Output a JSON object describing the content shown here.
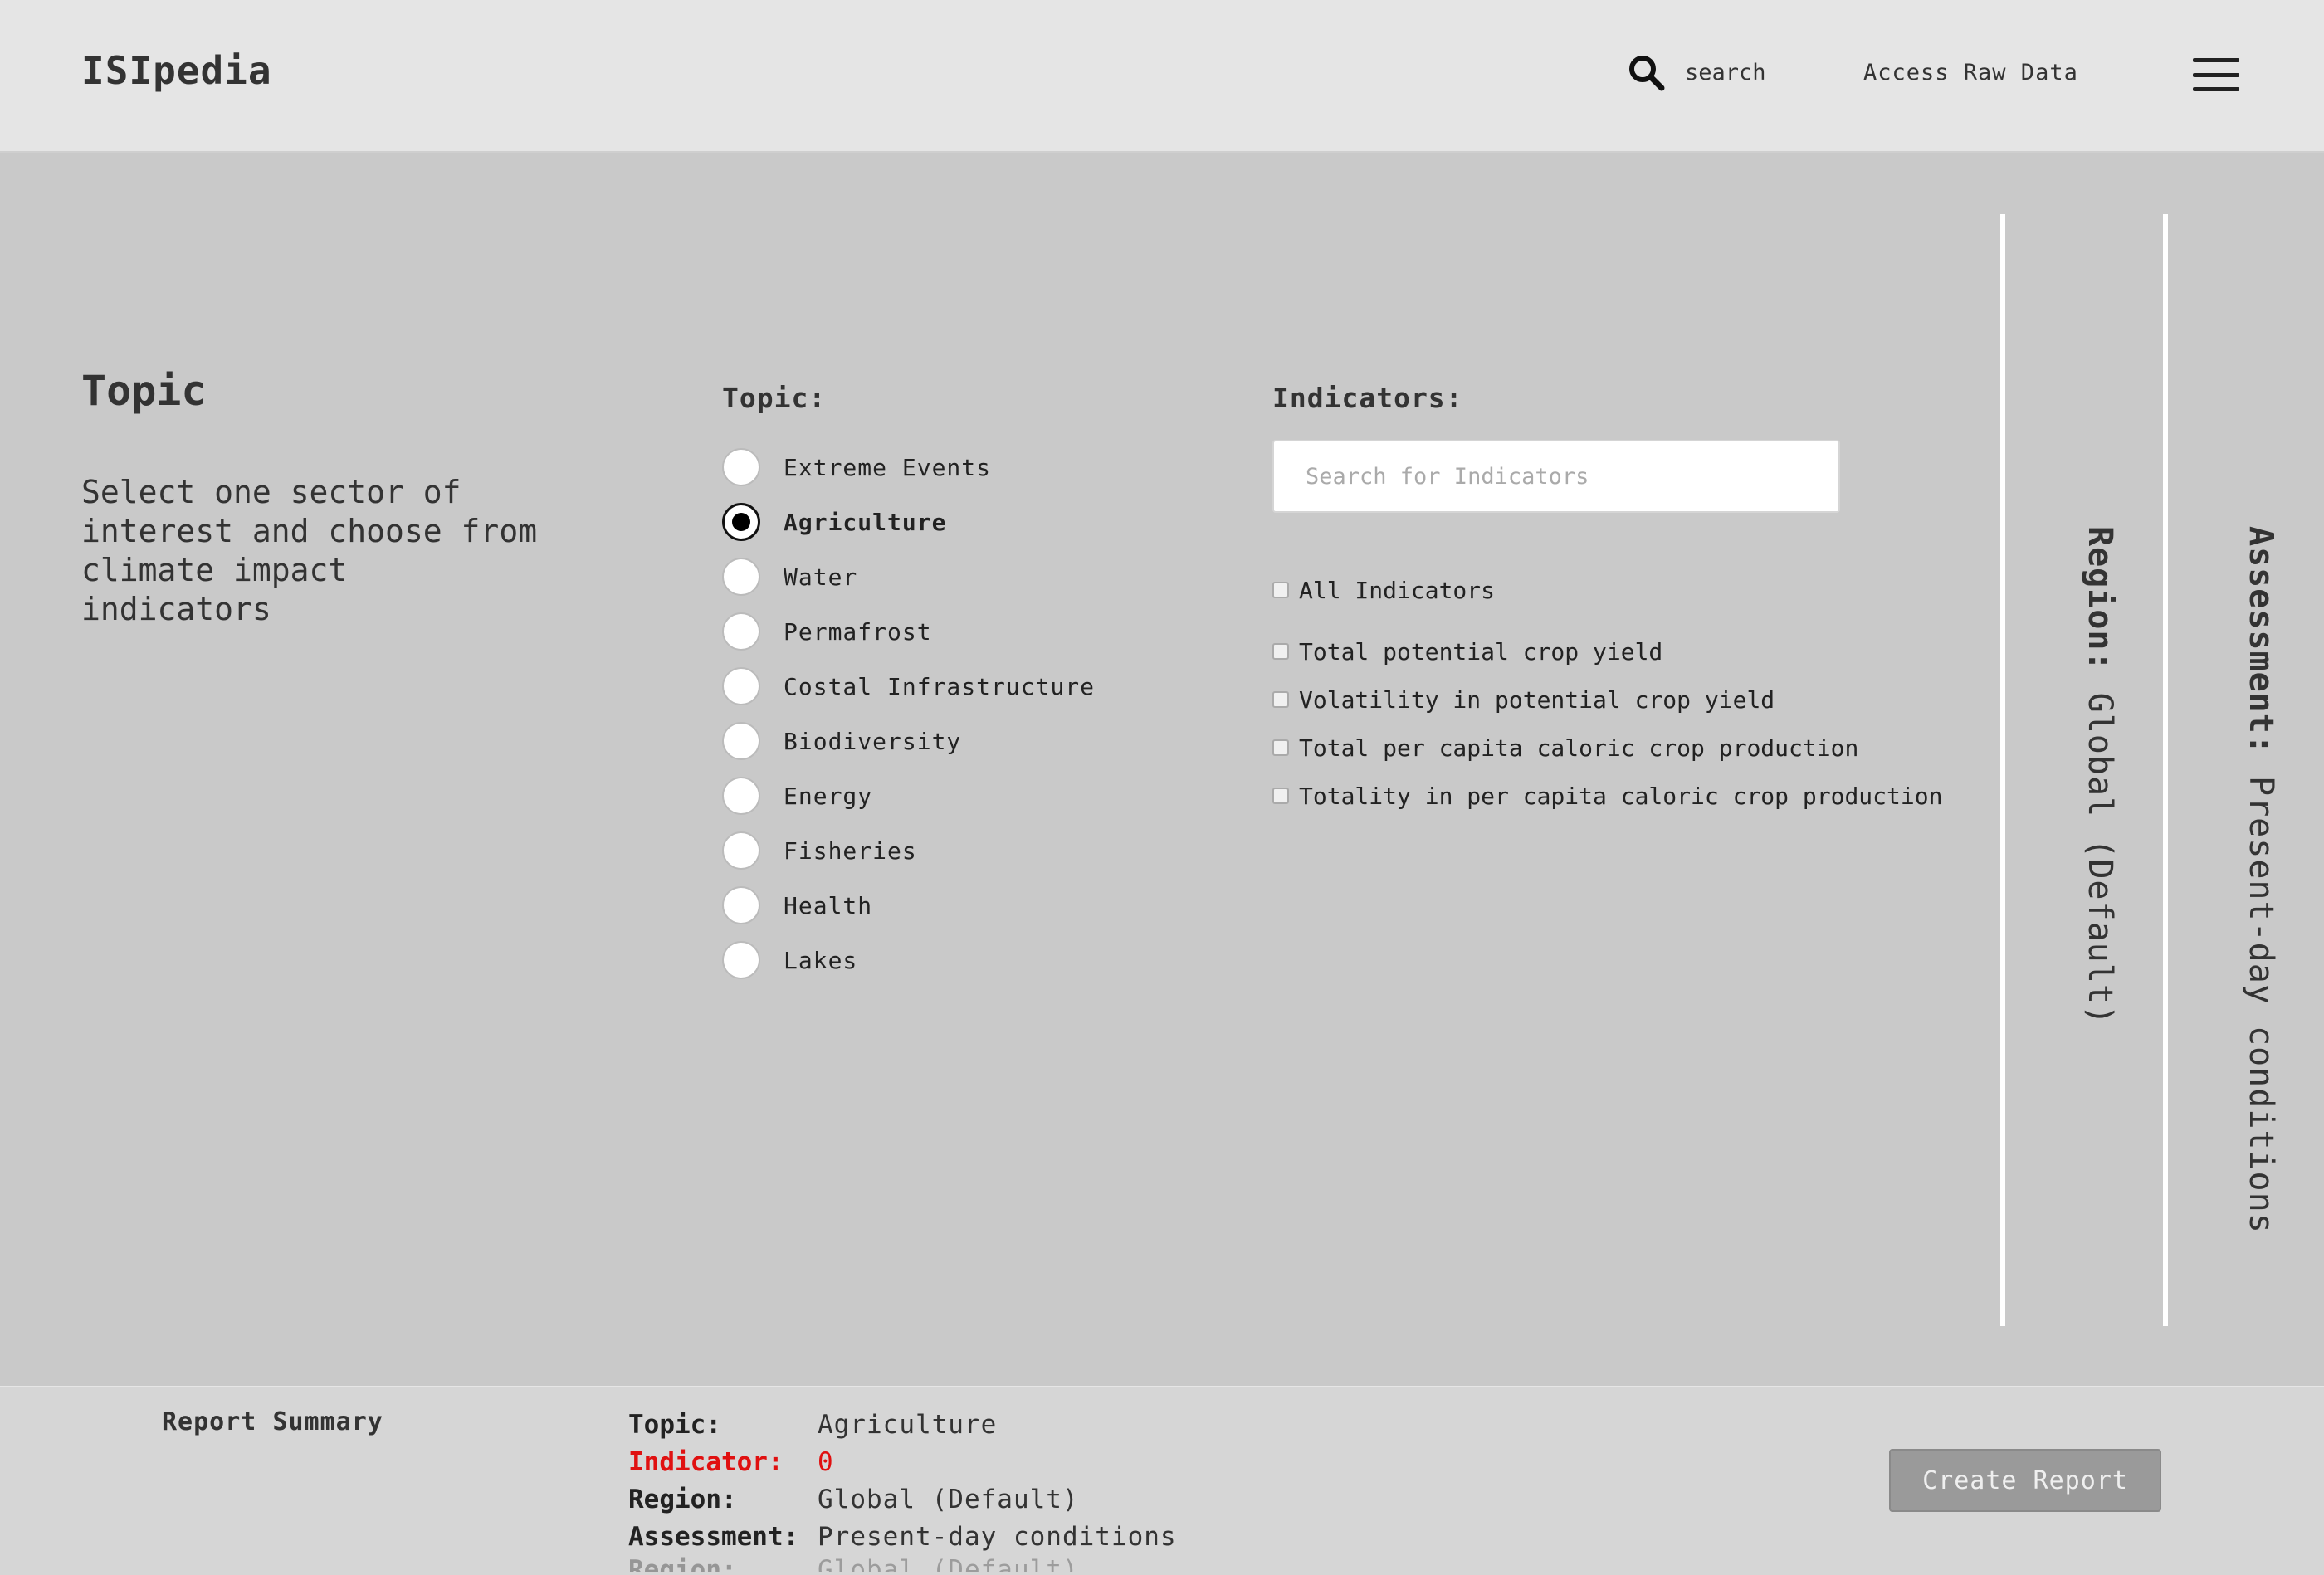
{
  "header": {
    "logo": "ISIpedia",
    "search_label": "search",
    "raw_data_link": "Access Raw Data"
  },
  "main": {
    "section_title": "Topic",
    "section_description": "Select one sector of interest and choose from climate impact indicators",
    "topic_heading": "Topic:",
    "topics": [
      {
        "label": "Extreme Events",
        "selected": false
      },
      {
        "label": "Agriculture",
        "selected": true
      },
      {
        "label": "Water",
        "selected": false
      },
      {
        "label": "Permafrost",
        "selected": false
      },
      {
        "label": "Costal Infrastructure",
        "selected": false
      },
      {
        "label": "Biodiversity",
        "selected": false
      },
      {
        "label": "Energy",
        "selected": false
      },
      {
        "label": "Fisheries",
        "selected": false
      },
      {
        "label": "Health",
        "selected": false
      },
      {
        "label": "Lakes",
        "selected": false
      }
    ],
    "indicators_heading": "Indicators:",
    "indicator_search_placeholder": "Search for Indicators",
    "all_indicators_label": "All Indicators",
    "indicators": [
      "Total potential crop yield",
      "Volatility in potential crop yield",
      "Total per capita caloric crop production",
      "Totality in per capita caloric crop production"
    ]
  },
  "side_panels": {
    "region_key": "Region:",
    "region_value": "Global (Default)",
    "assessment_key": "Assessment:",
    "assessment_value": "Present-day conditions"
  },
  "footer": {
    "title": "Report Summary",
    "summary": {
      "topic_key": "Topic:",
      "topic_value": "Agriculture",
      "indicator_key": "Indicator:",
      "indicator_value": "0",
      "region_key": "Region:",
      "region_value": "Global (Default)",
      "assessment_key": "Assessment:",
      "assessment_value": "Present-day conditions",
      "ghost_key": "Region:",
      "ghost_value": "Global (Default)"
    },
    "create_button": "Create Report"
  },
  "colors": {
    "header_bg": "#e5e5e5",
    "main_bg": "#c9c9c9",
    "footer_bg": "#d6d6d6",
    "alert": "#e01010",
    "button_bg": "#9a9a9a"
  }
}
